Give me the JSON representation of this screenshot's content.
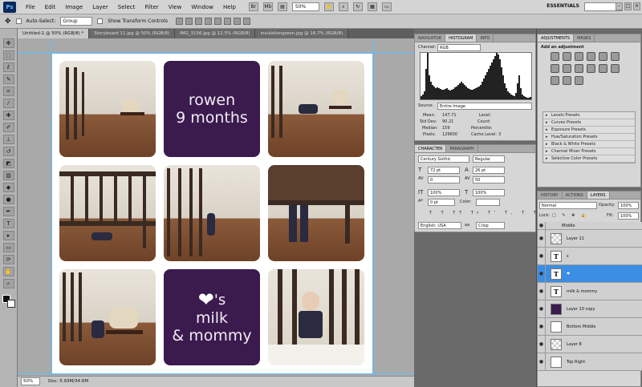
{
  "menubar": {
    "logo": "Ps",
    "items": [
      "File",
      "Edit",
      "Image",
      "Layer",
      "Select",
      "Filter",
      "View",
      "Window",
      "Help"
    ],
    "zoom": "50%",
    "workspace": "ESSENTIALS"
  },
  "optbar": {
    "auto_select_label": "Auto-Select:",
    "auto_select_value": "Group",
    "transform_label": "Show Transform Controls"
  },
  "tabs": [
    {
      "label": "Untitled-1 @ 50% (RGB/8) *",
      "active": true
    },
    {
      "label": "Storyboard 11.jpg @ 50% (RGB/8)",
      "active": false
    },
    {
      "label": "IMG_3156.jpg @ 12.5% (RGB/8)",
      "active": false
    },
    {
      "label": "insulationgreen.jpg @ 16.7% (RGB/8)",
      "active": false
    }
  ],
  "canvas": {
    "tile_top_text_1": "rowen",
    "tile_top_text_2": "9 months",
    "tile_bottom_heart": "❤",
    "tile_bottom_s": "'s",
    "tile_bottom_text_1": "milk",
    "tile_bottom_text_2": "& mommy",
    "purple": "#3b1a4e"
  },
  "statusbar": {
    "zoom": "50%",
    "doc": "Doc: 5.93M/34.6M"
  },
  "histogram_panel": {
    "tabs": [
      "NAVIGATOR",
      "HISTOGRAM",
      "INFO"
    ],
    "channel_label": "Channel:",
    "channel_value": "RGB",
    "source_label": "Source:",
    "source_value": "Entire Image",
    "mean_label": "Mean:",
    "mean_value": "147.71",
    "stddev_label": "Std Dev:",
    "stddev_value": "90.21",
    "median_label": "Median:",
    "median_value": "159",
    "pixels_label": "Pixels:",
    "pixels_value": "129600",
    "level_label": "Level:",
    "count_label": "Count:",
    "percentile_label": "Percentile:",
    "cache_label": "Cache Level:",
    "cache_value": "3"
  },
  "character_panel": {
    "tabs": [
      "CHARACTER",
      "PARAGRAPH"
    ],
    "font": "Century Gothic",
    "style": "Regular",
    "size": "72 pt",
    "leading": "26 pt",
    "kerning": "0",
    "tracking": "50",
    "vscale": "100%",
    "hscale": "100%",
    "baseline": "0 pt",
    "color_label": "Color:",
    "language": "English: USA",
    "aa": "Crisp"
  },
  "adjustments_panel": {
    "tabs": [
      "ADJUSTMENTS",
      "MASKS"
    ],
    "title": "Add an adjustment",
    "presets": [
      "Levels Presets",
      "Curves Presets",
      "Exposure Presets",
      "Hue/Saturation Presets",
      "Black & White Presets",
      "Channel Mixer Presets",
      "Selective Color Presets"
    ]
  },
  "layers_panel": {
    "tabs": [
      "HISTORY",
      "ACTIONS",
      "LAYERS"
    ],
    "blend": "Normal",
    "opacity_label": "Opacity:",
    "opacity": "100%",
    "lock_label": "Lock:",
    "fill_label": "Fill:",
    "fill": "100%",
    "layers": [
      {
        "name": "Middle",
        "thumb": "checker",
        "selected": false
      },
      {
        "name": "Layer 11",
        "thumb": "checker",
        "selected": false
      },
      {
        "name": "s",
        "thumb": "T",
        "selected": false
      },
      {
        "name": "❤",
        "thumb": "T",
        "selected": true
      },
      {
        "name": "milk  & mommy",
        "thumb": "T",
        "selected": false
      },
      {
        "name": "Layer 10 copy",
        "thumb": "purple",
        "selected": false
      },
      {
        "name": "Bottom Middle",
        "thumb": "blank",
        "selected": false
      },
      {
        "name": "Layer 8",
        "thumb": "checker",
        "selected": false
      },
      {
        "name": "Top Right",
        "thumb": "blank",
        "selected": false
      }
    ]
  }
}
